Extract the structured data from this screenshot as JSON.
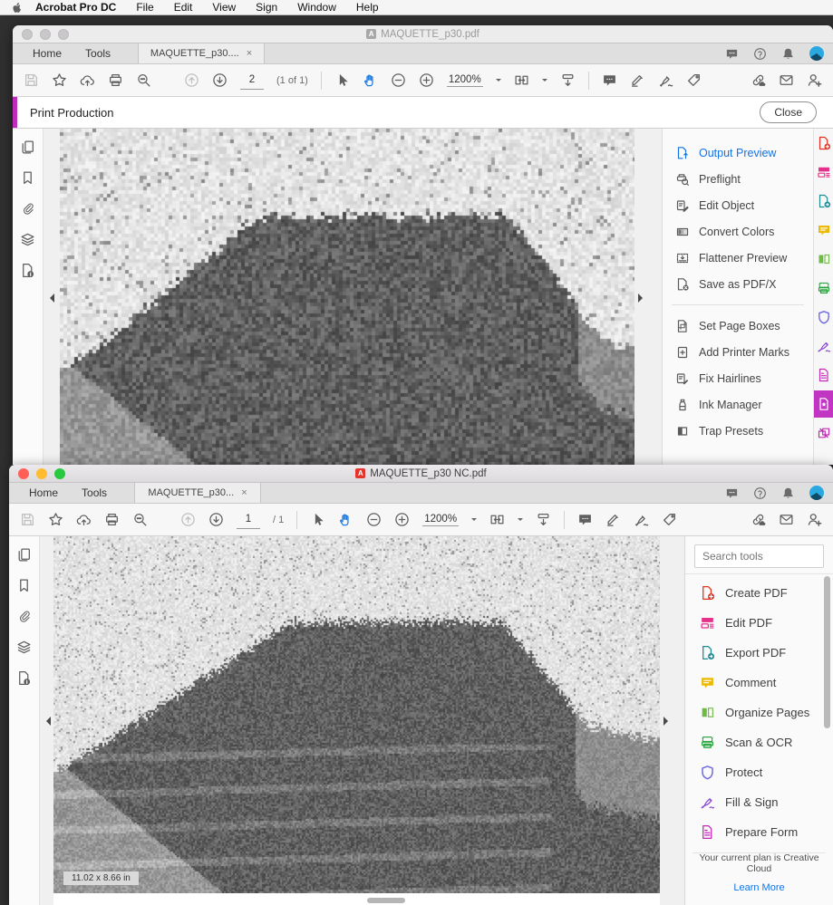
{
  "menu_bar": {
    "app_name": "Acrobat Pro DC",
    "items": [
      "File",
      "Edit",
      "View",
      "Sign",
      "Window",
      "Help"
    ]
  },
  "colors": {
    "accent_blue": "#1473E6",
    "print_production_magenta": "#BF2CBB",
    "selected_tool_magenta": "#C235C2",
    "hand_tool_blue": "#1E7BE0",
    "pdf_icon_red": "#E4342B"
  },
  "window_top": {
    "titlebar": {
      "title": "MAQUETTE_p30.pdf"
    },
    "tabs": {
      "home": "Home",
      "tools": "Tools",
      "doc": "MAQUETTE_p30....",
      "close": "×"
    },
    "toolbar": {
      "page_value": "2",
      "page_info": "(1 of 1)",
      "zoom_value": "1200%"
    },
    "print_production": {
      "title": "Print Production",
      "close_label": "Close",
      "group1": [
        {
          "label": "Output Preview",
          "icon": "output-preview",
          "active": true
        },
        {
          "label": "Preflight",
          "icon": "preflight"
        },
        {
          "label": "Edit Object",
          "icon": "edit-object"
        },
        {
          "label": "Convert Colors",
          "icon": "convert-colors"
        },
        {
          "label": "Flattener Preview",
          "icon": "flattener-preview"
        },
        {
          "label": "Save as PDF/X",
          "icon": "save-as-pdfx"
        }
      ],
      "group2": [
        {
          "label": "Set Page Boxes",
          "icon": "set-page-boxes"
        },
        {
          "label": "Add Printer Marks",
          "icon": "add-printer-marks"
        },
        {
          "label": "Fix Hairlines",
          "icon": "fix-hairlines"
        },
        {
          "label": "Ink Manager",
          "icon": "ink-manager"
        },
        {
          "label": "Trap Presets",
          "icon": "trap-presets"
        }
      ]
    }
  },
  "window_bottom": {
    "titlebar": {
      "title": "MAQUETTE_p30 NC.pdf"
    },
    "tabs": {
      "home": "Home",
      "tools": "Tools",
      "doc": "MAQUETTE_p30...",
      "close": "×"
    },
    "toolbar": {
      "page_value": "1",
      "page_total": "/ 1",
      "zoom_value": "1200%"
    },
    "tools_panel": {
      "search_placeholder": "Search tools",
      "items": [
        {
          "label": "Create PDF",
          "icon": "create-pdf"
        },
        {
          "label": "Edit PDF",
          "icon": "edit-pdf"
        },
        {
          "label": "Export PDF",
          "icon": "export-pdf"
        },
        {
          "label": "Comment",
          "icon": "comment"
        },
        {
          "label": "Organize Pages",
          "icon": "organize-pages"
        },
        {
          "label": "Scan & OCR",
          "icon": "scan-ocr"
        },
        {
          "label": "Protect",
          "icon": "protect"
        },
        {
          "label": "Fill & Sign",
          "icon": "fill-sign"
        },
        {
          "label": "Prepare Form",
          "icon": "prepare-form"
        }
      ],
      "plan_text": "Your current plan is Creative Cloud",
      "learn_more_label": "Learn More"
    },
    "size_indicator": "11.02 x 8.66 in"
  }
}
